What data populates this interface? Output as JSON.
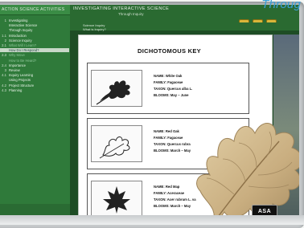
{
  "tagline": "Throug",
  "sidebar": {
    "header": "ACTION SCIENCE ACTIVITIES",
    "items": [
      {
        "num": "1",
        "label": "Investigating",
        "style": "normal"
      },
      {
        "num": "",
        "label": "Interactive Science",
        "style": "normal"
      },
      {
        "num": "",
        "label": "Through Inquiry",
        "style": "normal"
      },
      {
        "num": "1.1",
        "label": "Introduction",
        "style": "normal"
      },
      {
        "num": "2",
        "label": "Science Inquiry",
        "style": "normal"
      },
      {
        "num": "2.1",
        "label": "What Will I Learn?",
        "style": "dim"
      },
      {
        "num": "2.2",
        "label": "How Do I Respond?",
        "style": "highlight"
      },
      {
        "num": "2.3",
        "label": "Why Move",
        "style": "dim"
      },
      {
        "num": "",
        "label": "How to Be Heard?",
        "style": "dim"
      },
      {
        "num": "2.4",
        "label": "Importance",
        "style": "normal"
      },
      {
        "num": "3",
        "label": "Review",
        "style": "normal"
      },
      {
        "num": "4.1",
        "label": "Inquiry Learning",
        "style": "normal"
      },
      {
        "num": "",
        "label": "Using Projects",
        "style": "normal"
      },
      {
        "num": "4.2",
        "label": "Project Structure",
        "style": "normal"
      },
      {
        "num": "4.3",
        "label": "Planning",
        "style": "normal"
      }
    ]
  },
  "titlebar": {
    "title": "INVESTIGATING INTERACTIVE SCIENCE",
    "subtitle": "Through Inquiry"
  },
  "crumbs": {
    "line1": "Science Inquiry",
    "line2": "What is Inquiry?"
  },
  "content": {
    "key_title": "DICHOTOMOUS KEY",
    "cards": [
      {
        "name": "NAME: White Oak",
        "family": "FAMILY: Fagaceae",
        "taxon": "TAXON: Quercus alba L.",
        "blooms": "BLOOMS: May – June"
      },
      {
        "name": "NAME: Red Oak",
        "family": "FAMILY: Fagaceae",
        "taxon": "TAXON: Quercus rubra",
        "blooms": "BLOOMS: March – May"
      },
      {
        "name": "NAME: Red Map",
        "family": "FAMILY: Aceraceae",
        "taxon": "TAXON: Acer rubrum L. va",
        "blooms": "BLOOMS: March – May"
      }
    ]
  },
  "badge": "ASA",
  "colors": {
    "sidebar_bg": "#2f7a3a",
    "titlebar_bg": "#2a6a31",
    "tagline": "#3a9fd8",
    "leaf": "#cdb48a"
  }
}
